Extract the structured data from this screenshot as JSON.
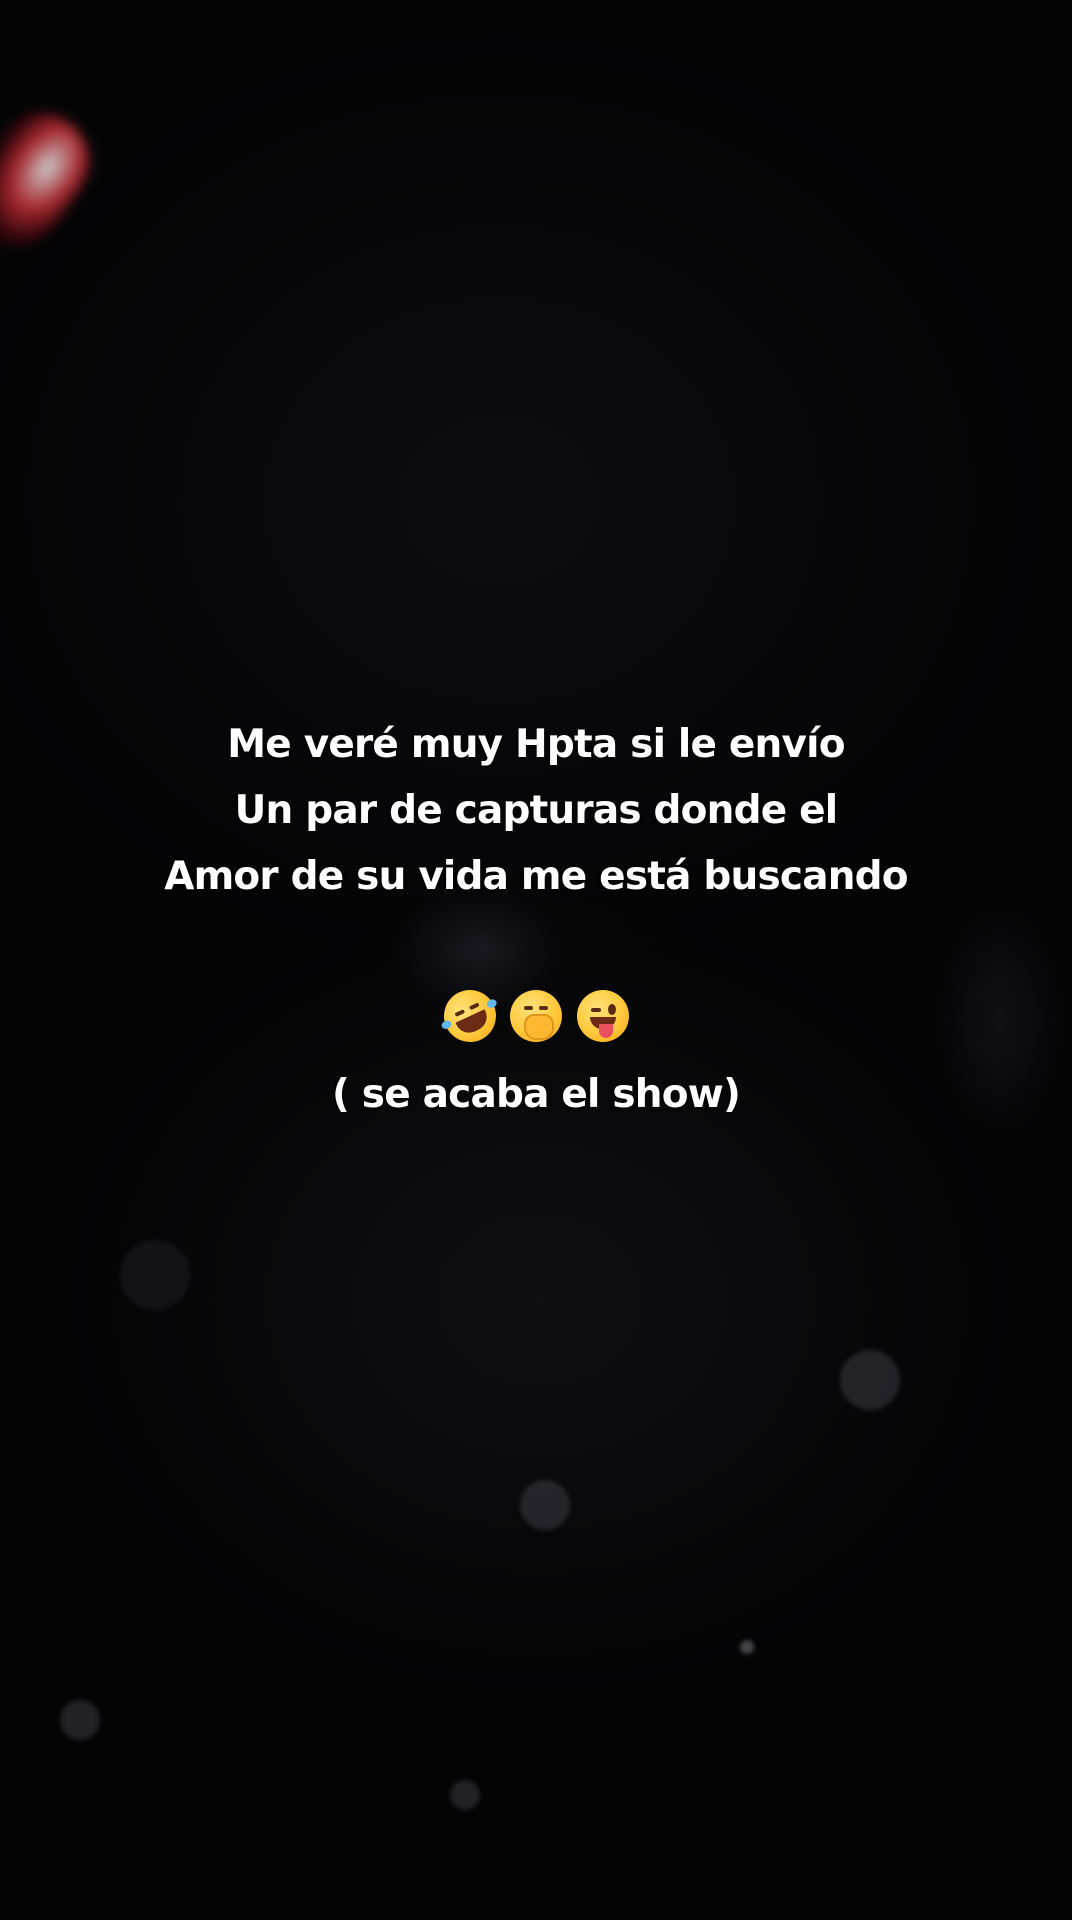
{
  "caption": {
    "lines": [
      "Me veré muy Hpta si le envío",
      "Un par de capturas donde el",
      "Amor de su vida me está buscando"
    ],
    "footer": "( se acaba el show)"
  },
  "emojis": [
    {
      "icon": "rolling-on-floor-laughing-icon",
      "char": "🤣"
    },
    {
      "icon": "face-with-hand-over-mouth-icon",
      "char": "🤭"
    },
    {
      "icon": "winking-face-with-tongue-icon",
      "char": "😜"
    }
  ]
}
